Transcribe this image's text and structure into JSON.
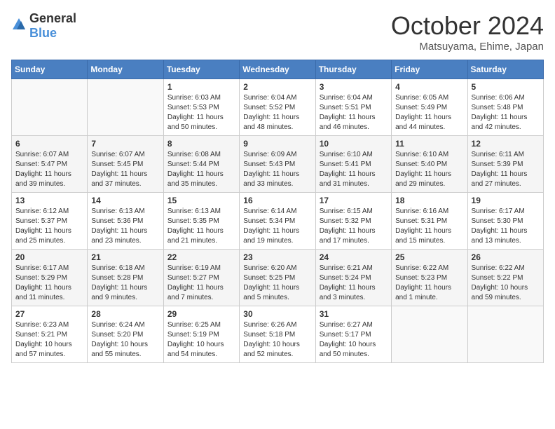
{
  "logo": {
    "general": "General",
    "blue": "Blue"
  },
  "header": {
    "month": "October 2024",
    "location": "Matsuyama, Ehime, Japan"
  },
  "weekdays": [
    "Sunday",
    "Monday",
    "Tuesday",
    "Wednesday",
    "Thursday",
    "Friday",
    "Saturday"
  ],
  "weeks": [
    [
      {
        "day": "",
        "sunrise": "",
        "sunset": "",
        "daylight": ""
      },
      {
        "day": "",
        "sunrise": "",
        "sunset": "",
        "daylight": ""
      },
      {
        "day": "1",
        "sunrise": "Sunrise: 6:03 AM",
        "sunset": "Sunset: 5:53 PM",
        "daylight": "Daylight: 11 hours and 50 minutes."
      },
      {
        "day": "2",
        "sunrise": "Sunrise: 6:04 AM",
        "sunset": "Sunset: 5:52 PM",
        "daylight": "Daylight: 11 hours and 48 minutes."
      },
      {
        "day": "3",
        "sunrise": "Sunrise: 6:04 AM",
        "sunset": "Sunset: 5:51 PM",
        "daylight": "Daylight: 11 hours and 46 minutes."
      },
      {
        "day": "4",
        "sunrise": "Sunrise: 6:05 AM",
        "sunset": "Sunset: 5:49 PM",
        "daylight": "Daylight: 11 hours and 44 minutes."
      },
      {
        "day": "5",
        "sunrise": "Sunrise: 6:06 AM",
        "sunset": "Sunset: 5:48 PM",
        "daylight": "Daylight: 11 hours and 42 minutes."
      }
    ],
    [
      {
        "day": "6",
        "sunrise": "Sunrise: 6:07 AM",
        "sunset": "Sunset: 5:47 PM",
        "daylight": "Daylight: 11 hours and 39 minutes."
      },
      {
        "day": "7",
        "sunrise": "Sunrise: 6:07 AM",
        "sunset": "Sunset: 5:45 PM",
        "daylight": "Daylight: 11 hours and 37 minutes."
      },
      {
        "day": "8",
        "sunrise": "Sunrise: 6:08 AM",
        "sunset": "Sunset: 5:44 PM",
        "daylight": "Daylight: 11 hours and 35 minutes."
      },
      {
        "day": "9",
        "sunrise": "Sunrise: 6:09 AM",
        "sunset": "Sunset: 5:43 PM",
        "daylight": "Daylight: 11 hours and 33 minutes."
      },
      {
        "day": "10",
        "sunrise": "Sunrise: 6:10 AM",
        "sunset": "Sunset: 5:41 PM",
        "daylight": "Daylight: 11 hours and 31 minutes."
      },
      {
        "day": "11",
        "sunrise": "Sunrise: 6:10 AM",
        "sunset": "Sunset: 5:40 PM",
        "daylight": "Daylight: 11 hours and 29 minutes."
      },
      {
        "day": "12",
        "sunrise": "Sunrise: 6:11 AM",
        "sunset": "Sunset: 5:39 PM",
        "daylight": "Daylight: 11 hours and 27 minutes."
      }
    ],
    [
      {
        "day": "13",
        "sunrise": "Sunrise: 6:12 AM",
        "sunset": "Sunset: 5:37 PM",
        "daylight": "Daylight: 11 hours and 25 minutes."
      },
      {
        "day": "14",
        "sunrise": "Sunrise: 6:13 AM",
        "sunset": "Sunset: 5:36 PM",
        "daylight": "Daylight: 11 hours and 23 minutes."
      },
      {
        "day": "15",
        "sunrise": "Sunrise: 6:13 AM",
        "sunset": "Sunset: 5:35 PM",
        "daylight": "Daylight: 11 hours and 21 minutes."
      },
      {
        "day": "16",
        "sunrise": "Sunrise: 6:14 AM",
        "sunset": "Sunset: 5:34 PM",
        "daylight": "Daylight: 11 hours and 19 minutes."
      },
      {
        "day": "17",
        "sunrise": "Sunrise: 6:15 AM",
        "sunset": "Sunset: 5:32 PM",
        "daylight": "Daylight: 11 hours and 17 minutes."
      },
      {
        "day": "18",
        "sunrise": "Sunrise: 6:16 AM",
        "sunset": "Sunset: 5:31 PM",
        "daylight": "Daylight: 11 hours and 15 minutes."
      },
      {
        "day": "19",
        "sunrise": "Sunrise: 6:17 AM",
        "sunset": "Sunset: 5:30 PM",
        "daylight": "Daylight: 11 hours and 13 minutes."
      }
    ],
    [
      {
        "day": "20",
        "sunrise": "Sunrise: 6:17 AM",
        "sunset": "Sunset: 5:29 PM",
        "daylight": "Daylight: 11 hours and 11 minutes."
      },
      {
        "day": "21",
        "sunrise": "Sunrise: 6:18 AM",
        "sunset": "Sunset: 5:28 PM",
        "daylight": "Daylight: 11 hours and 9 minutes."
      },
      {
        "day": "22",
        "sunrise": "Sunrise: 6:19 AM",
        "sunset": "Sunset: 5:27 PM",
        "daylight": "Daylight: 11 hours and 7 minutes."
      },
      {
        "day": "23",
        "sunrise": "Sunrise: 6:20 AM",
        "sunset": "Sunset: 5:25 PM",
        "daylight": "Daylight: 11 hours and 5 minutes."
      },
      {
        "day": "24",
        "sunrise": "Sunrise: 6:21 AM",
        "sunset": "Sunset: 5:24 PM",
        "daylight": "Daylight: 11 hours and 3 minutes."
      },
      {
        "day": "25",
        "sunrise": "Sunrise: 6:22 AM",
        "sunset": "Sunset: 5:23 PM",
        "daylight": "Daylight: 11 hours and 1 minute."
      },
      {
        "day": "26",
        "sunrise": "Sunrise: 6:22 AM",
        "sunset": "Sunset: 5:22 PM",
        "daylight": "Daylight: 10 hours and 59 minutes."
      }
    ],
    [
      {
        "day": "27",
        "sunrise": "Sunrise: 6:23 AM",
        "sunset": "Sunset: 5:21 PM",
        "daylight": "Daylight: 10 hours and 57 minutes."
      },
      {
        "day": "28",
        "sunrise": "Sunrise: 6:24 AM",
        "sunset": "Sunset: 5:20 PM",
        "daylight": "Daylight: 10 hours and 55 minutes."
      },
      {
        "day": "29",
        "sunrise": "Sunrise: 6:25 AM",
        "sunset": "Sunset: 5:19 PM",
        "daylight": "Daylight: 10 hours and 54 minutes."
      },
      {
        "day": "30",
        "sunrise": "Sunrise: 6:26 AM",
        "sunset": "Sunset: 5:18 PM",
        "daylight": "Daylight: 10 hours and 52 minutes."
      },
      {
        "day": "31",
        "sunrise": "Sunrise: 6:27 AM",
        "sunset": "Sunset: 5:17 PM",
        "daylight": "Daylight: 10 hours and 50 minutes."
      },
      {
        "day": "",
        "sunrise": "",
        "sunset": "",
        "daylight": ""
      },
      {
        "day": "",
        "sunrise": "",
        "sunset": "",
        "daylight": ""
      }
    ]
  ]
}
